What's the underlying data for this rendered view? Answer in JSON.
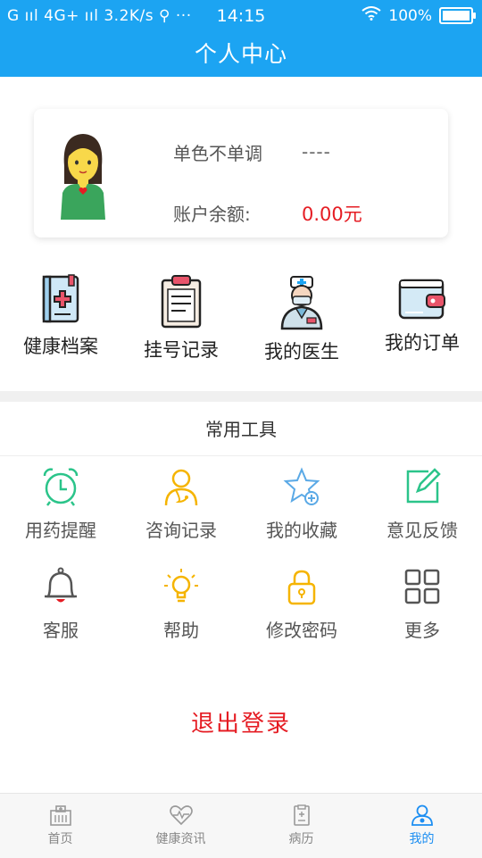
{
  "status_bar": {
    "left": "G ııl 4G+ ııl 3.2K/s ⚲ ···",
    "time": "14:15",
    "battery": "100%"
  },
  "title": "个人中心",
  "profile": {
    "name": "单色不单调",
    "name_value": "----",
    "balance_label": "账户余额:",
    "balance_value": "0.00元"
  },
  "quick_links": [
    {
      "label": "健康档案",
      "icon": "health-record-icon"
    },
    {
      "label": "挂号记录",
      "icon": "clipboard-icon"
    },
    {
      "label": "我的医生",
      "icon": "doctor-icon"
    },
    {
      "label": "我的订单",
      "icon": "wallet-icon"
    }
  ],
  "tools": {
    "title": "常用工具",
    "items": [
      {
        "label": "用药提醒",
        "icon": "alarm-clock-icon",
        "color": "#2bc48a"
      },
      {
        "label": "咨询记录",
        "icon": "person-icon",
        "color": "#f5b400"
      },
      {
        "label": "我的收藏",
        "icon": "star-icon",
        "color": "#5aa9e6"
      },
      {
        "label": "意见反馈",
        "icon": "edit-icon",
        "color": "#2bc48a"
      },
      {
        "label": "客服",
        "icon": "bell-icon",
        "color": "#555555"
      },
      {
        "label": "帮助",
        "icon": "lightbulb-icon",
        "color": "#f5b400"
      },
      {
        "label": "修改密码",
        "icon": "lock-icon",
        "color": "#f5b400"
      },
      {
        "label": "更多",
        "icon": "grid-icon",
        "color": "#555555"
      }
    ]
  },
  "logout": "退出登录",
  "tab_bar": [
    {
      "label": "首页",
      "icon": "hospital-icon",
      "active": false
    },
    {
      "label": "健康资讯",
      "icon": "heart-pulse-icon",
      "active": false
    },
    {
      "label": "病历",
      "icon": "document-icon",
      "active": false
    },
    {
      "label": "我的",
      "icon": "user-icon",
      "active": true
    }
  ],
  "colors": {
    "brand": "#1ca4f2",
    "accent_red": "#e51c23",
    "active_tab": "#1c8ef2"
  }
}
